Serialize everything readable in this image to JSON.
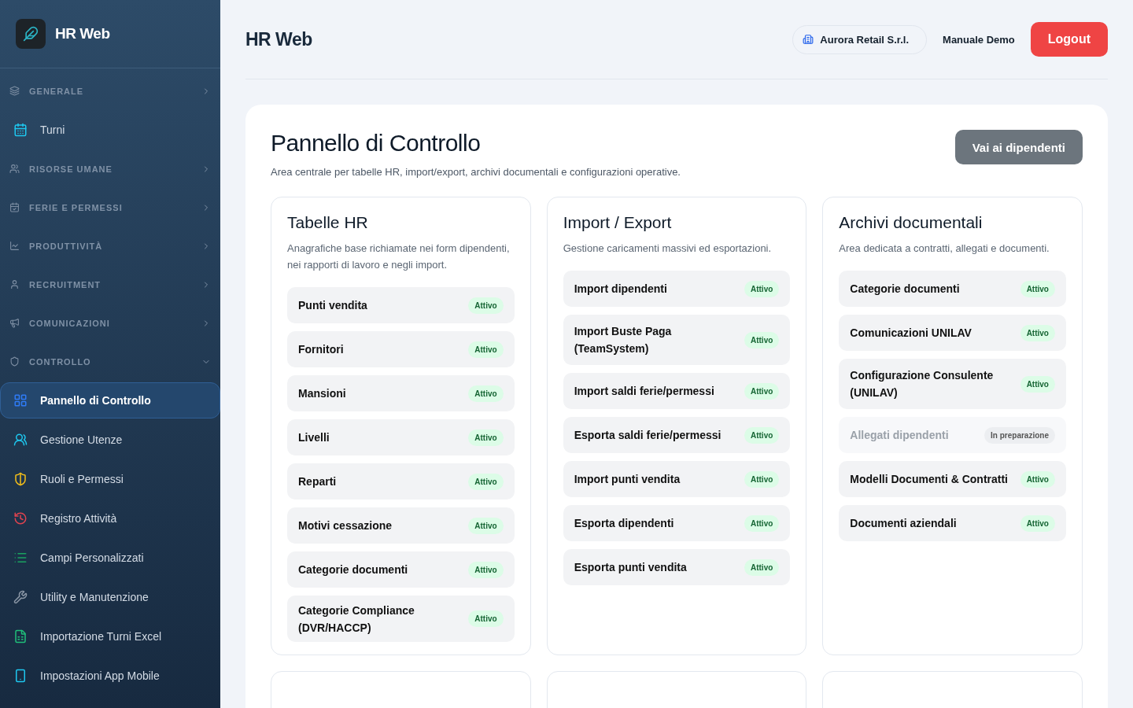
{
  "brand": {
    "name": "HR Web"
  },
  "sidebar": {
    "items": [
      {
        "kind": "section",
        "label": "GENERALE",
        "expanded": false
      },
      {
        "kind": "link",
        "label": "Turni",
        "selected": false
      },
      {
        "kind": "section",
        "label": "RISORSE UMANE",
        "expanded": false
      },
      {
        "kind": "section",
        "label": "FERIE E PERMESSI",
        "expanded": false
      },
      {
        "kind": "section",
        "label": "PRODUTTIVITÀ",
        "expanded": false
      },
      {
        "kind": "section",
        "label": "RECRUITMENT",
        "expanded": false
      },
      {
        "kind": "section",
        "label": "COMUNICAZIONI",
        "expanded": false
      },
      {
        "kind": "section",
        "label": "CONTROLLO",
        "expanded": true
      },
      {
        "kind": "link",
        "label": "Pannello di Controllo",
        "selected": true
      },
      {
        "kind": "link",
        "label": "Gestione Utenze",
        "selected": false
      },
      {
        "kind": "link",
        "label": "Ruoli e Permessi",
        "selected": false
      },
      {
        "kind": "link",
        "label": "Registro Attività",
        "selected": false
      },
      {
        "kind": "link",
        "label": "Campi Personalizzati",
        "selected": false
      },
      {
        "kind": "link",
        "label": "Utility e Manutenzione",
        "selected": false
      },
      {
        "kind": "link",
        "label": "Importazione Turni Excel",
        "selected": false
      },
      {
        "kind": "link",
        "label": "Impostazioni App Mobile",
        "selected": false
      }
    ]
  },
  "header": {
    "title": "HR Web",
    "company": "Aurora Retail S.r.l.",
    "manual": "Manuale Demo",
    "logout": "Logout"
  },
  "panel": {
    "title": "Pannello di Controllo",
    "subtitle": "Area centrale per tabelle HR, import/export, archivi documentali e configurazioni operative.",
    "action": "Vai ai dipendenti",
    "cards": [
      {
        "title": "Tabelle HR",
        "description": "Anagrafiche base richiamate nei form dipendenti, nei rapporti di lavoro e negli import.",
        "items": [
          {
            "label": "Punti vendita",
            "status": "Attivo",
            "disabled": false
          },
          {
            "label": "Fornitori",
            "status": "Attivo",
            "disabled": false
          },
          {
            "label": "Mansioni",
            "status": "Attivo",
            "disabled": false
          },
          {
            "label": "Livelli",
            "status": "Attivo",
            "disabled": false
          },
          {
            "label": "Reparti",
            "status": "Attivo",
            "disabled": false
          },
          {
            "label": "Motivi cessazione",
            "status": "Attivo",
            "disabled": false
          },
          {
            "label": "Categorie documenti",
            "status": "Attivo",
            "disabled": false
          },
          {
            "label": "Categorie Compliance (DVR/HACCP)",
            "status": "Attivo",
            "disabled": false
          }
        ]
      },
      {
        "title": "Import / Export",
        "description": "Gestione caricamenti massivi ed esportazioni.",
        "items": [
          {
            "label": "Import dipendenti",
            "status": "Attivo",
            "disabled": false
          },
          {
            "label": "Import Buste Paga (TeamSystem)",
            "status": "Attivo",
            "disabled": false
          },
          {
            "label": "Import saldi ferie/permessi",
            "status": "Attivo",
            "disabled": false
          },
          {
            "label": "Esporta saldi ferie/permessi",
            "status": "Attivo",
            "disabled": false
          },
          {
            "label": "Import punti vendita",
            "status": "Attivo",
            "disabled": false
          },
          {
            "label": "Esporta dipendenti",
            "status": "Attivo",
            "disabled": false
          },
          {
            "label": "Esporta punti vendita",
            "status": "Attivo",
            "disabled": false
          }
        ]
      },
      {
        "title": "Archivi documentali",
        "description": "Area dedicata a contratti, allegati e documenti.",
        "items": [
          {
            "label": "Categorie documenti",
            "status": "Attivo",
            "disabled": false
          },
          {
            "label": "Comunicazioni UNILAV",
            "status": "Attivo",
            "disabled": false
          },
          {
            "label": "Configurazione Consulente (UNILAV)",
            "status": "Attivo",
            "disabled": false
          },
          {
            "label": "Allegati dipendenti",
            "status": "In preparazione",
            "disabled": true
          },
          {
            "label": "Modelli Documenti & Contratti",
            "status": "Attivo",
            "disabled": false
          },
          {
            "label": "Documenti aziendali",
            "status": "Attivo",
            "disabled": false
          }
        ]
      }
    ],
    "more_cards": [
      {
        "kind": "card"
      },
      {
        "kind": "card"
      },
      {
        "kind": "card"
      }
    ]
  }
}
